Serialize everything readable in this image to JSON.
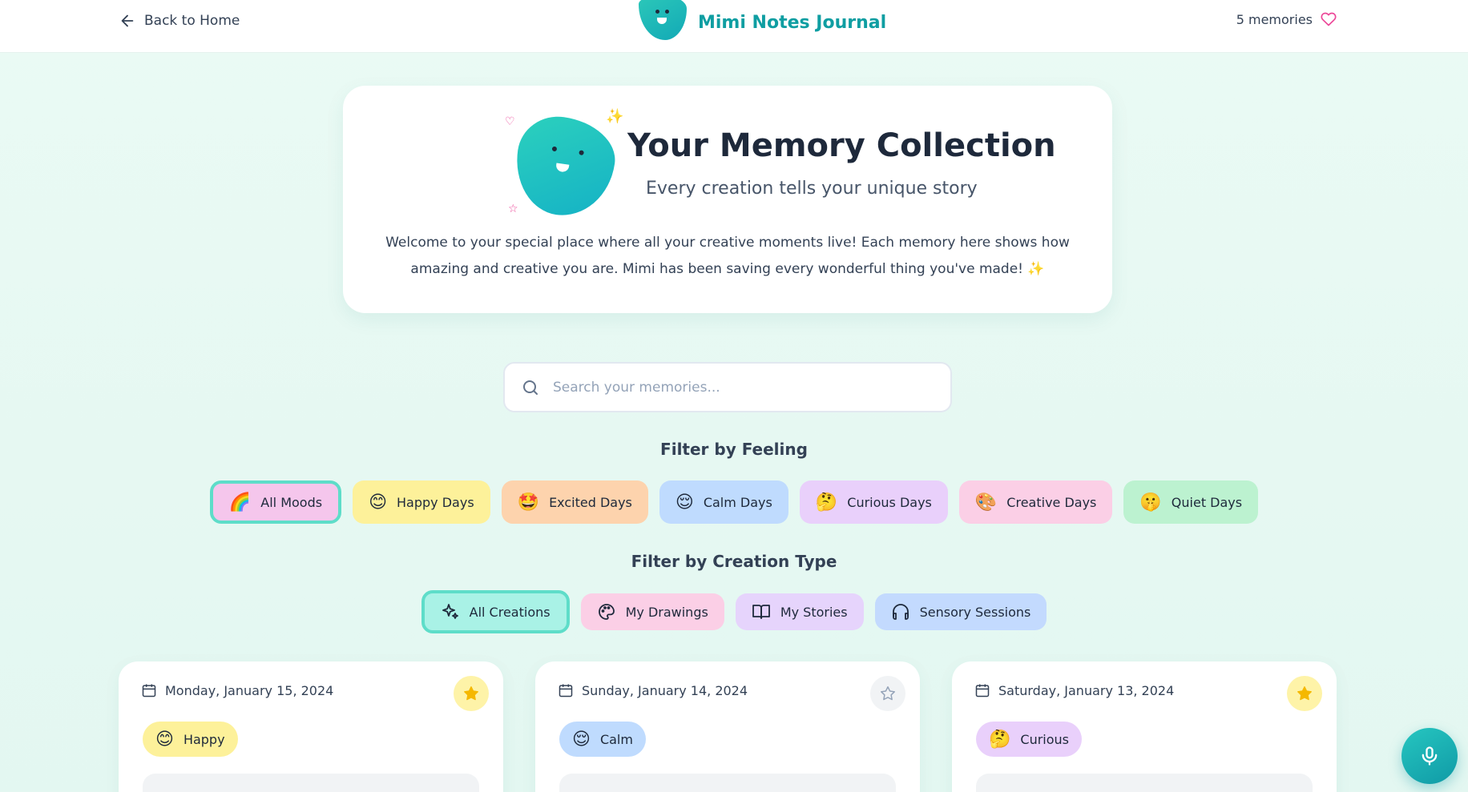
{
  "header": {
    "back_label": "Back to Home",
    "brand_name": "Mimi Notes Journal",
    "memory_count": "5 memories"
  },
  "hero": {
    "title": "Your Memory Collection",
    "subtitle": "Every creation tells your unique story",
    "description": "Welcome to your special place where all your creative moments live! Each memory here shows how amazing and creative you are. Mimi has been saving every wonderful thing you've made! ✨"
  },
  "search": {
    "placeholder": "Search your memories..."
  },
  "mood_filter": {
    "title": "Filter by Feeling",
    "options": [
      {
        "emoji": "🌈",
        "label": "All Moods",
        "color": "#f5c6ec",
        "active": true
      },
      {
        "emoji": "😊",
        "label": "Happy Days",
        "color": "#fdf19a"
      },
      {
        "emoji": "🤩",
        "label": "Excited Days",
        "color": "#fdd3ad"
      },
      {
        "emoji": "😌",
        "label": "Calm Days",
        "color": "#bfdbfe"
      },
      {
        "emoji": "🤔",
        "label": "Curious Days",
        "color": "#e9d0fb"
      },
      {
        "emoji": "🎨",
        "label": "Creative Days",
        "color": "#fbcfe6"
      },
      {
        "emoji": "🤫",
        "label": "Quiet Days",
        "color": "#bcf2d0"
      }
    ]
  },
  "type_filter": {
    "title": "Filter by Creation Type",
    "options": [
      {
        "icon": "sparkles-icon",
        "label": "All Creations",
        "color": "#a9f2e6",
        "active": true
      },
      {
        "icon": "palette-icon",
        "label": "My Drawings",
        "color": "#fbcfe6"
      },
      {
        "icon": "book-icon",
        "label": "My Stories",
        "color": "#e6d4fc"
      },
      {
        "icon": "headphones-icon",
        "label": "Sensory Sessions",
        "color": "#c3dafe"
      }
    ]
  },
  "cards": [
    {
      "date": "Monday, January 15, 2024",
      "mood_emoji": "😊",
      "mood": "Happy",
      "mood_color": "#fdf19a",
      "starred": true
    },
    {
      "date": "Sunday, January 14, 2024",
      "mood_emoji": "😌",
      "mood": "Calm",
      "mood_color": "#bfdbfe",
      "starred": false
    },
    {
      "date": "Saturday, January 13, 2024",
      "mood_emoji": "🤔",
      "mood": "Curious",
      "mood_color": "#e9d0fb",
      "starred": true
    }
  ],
  "colors": {
    "accent": "#0f9ea2",
    "background": "#e8f9f3",
    "star_active_bg": "#fef3a8",
    "star_active": "#f5b800",
    "heart": "#ec4899"
  }
}
